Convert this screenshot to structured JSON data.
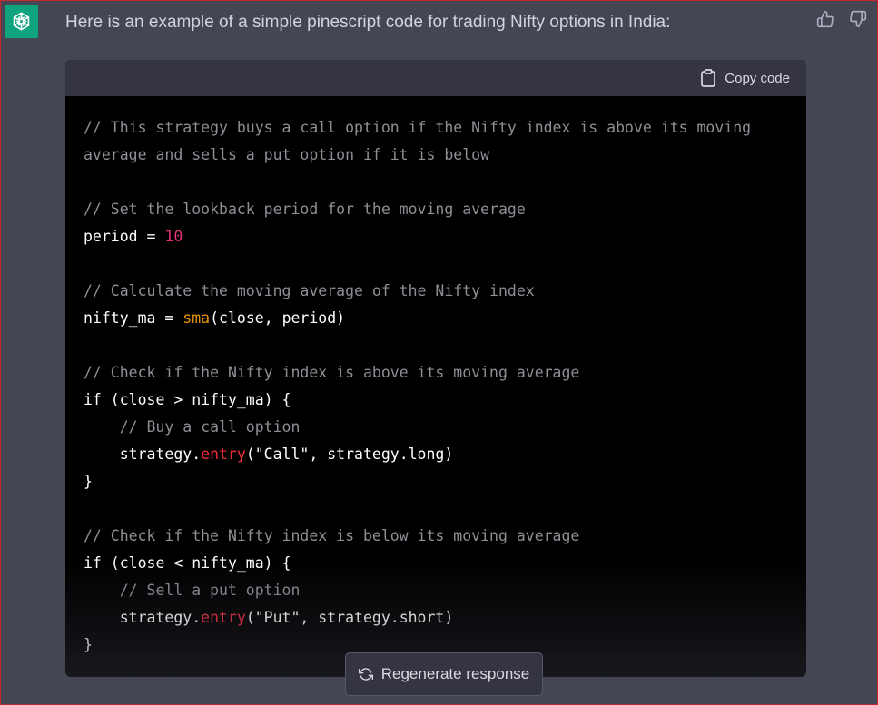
{
  "message": {
    "intro": "Here is an example of a simple pinescript code for trading Nifty options in India:",
    "avatar_icon": "openai-logo-icon",
    "avatar_color": "#10a37f"
  },
  "feedback": {
    "thumbs_up_icon": "thumbs-up-icon",
    "thumbs_down_icon": "thumbs-down-icon"
  },
  "code_block": {
    "copy_label": "Copy code",
    "copy_icon": "clipboard-icon",
    "lines": [
      [
        {
          "t": "// This strategy buys a call option if the Nifty index is above its moving",
          "c": "comment"
        }
      ],
      [
        {
          "t": "average and sells a put option if it is below",
          "c": "comment"
        }
      ],
      [],
      [
        {
          "t": "// Set the lookback period for the moving average",
          "c": "comment"
        }
      ],
      [
        {
          "t": "period = ",
          "c": "plain"
        },
        {
          "t": "10",
          "c": "num"
        }
      ],
      [],
      [
        {
          "t": "// Calculate the moving average of the Nifty index",
          "c": "comment"
        }
      ],
      [
        {
          "t": "nifty_ma = ",
          "c": "plain"
        },
        {
          "t": "sma",
          "c": "builtin"
        },
        {
          "t": "(close, period)",
          "c": "plain"
        }
      ],
      [],
      [
        {
          "t": "// Check if the Nifty index is above its moving average",
          "c": "comment"
        }
      ],
      [
        {
          "t": "if (close > nifty_ma) {",
          "c": "plain"
        }
      ],
      [
        {
          "t": "    // Buy a call option",
          "c": "comment"
        }
      ],
      [
        {
          "t": "    strategy.",
          "c": "plain"
        },
        {
          "t": "entry",
          "c": "fn"
        },
        {
          "t": "(\"Call\", strategy.long)",
          "c": "plain"
        }
      ],
      [
        {
          "t": "}",
          "c": "plain"
        }
      ],
      [],
      [
        {
          "t": "// Check if the Nifty index is below its moving average",
          "c": "comment"
        }
      ],
      [
        {
          "t": "if (close < nifty_ma) {",
          "c": "plain"
        }
      ],
      [
        {
          "t": "    // Sell a put option",
          "c": "comment"
        }
      ],
      [
        {
          "t": "    strategy.",
          "c": "plain"
        },
        {
          "t": "entry",
          "c": "fn"
        },
        {
          "t": "(\"Put\", strategy.short)",
          "c": "plain"
        }
      ],
      [
        {
          "t": "}",
          "c": "plain"
        }
      ]
    ]
  },
  "regenerate": {
    "label": "Regenerate response",
    "icon": "refresh-icon"
  },
  "colors": {
    "background": "#444654",
    "code_background": "#000000",
    "code_header": "#343541",
    "comment": "#8e8e96",
    "number": "#df3079",
    "function": "#f22c3d",
    "builtin": "#e9950c"
  }
}
